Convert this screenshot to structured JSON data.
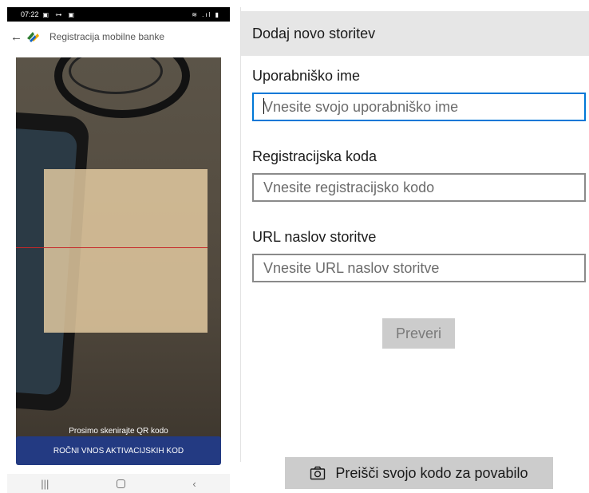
{
  "phone": {
    "status_time": "07:22",
    "status_left_icons": "▣ ⊶ ▣",
    "status_right_icons": "≋ .ıl ▮",
    "back_icon": "←",
    "app_title": "Registracija mobilne banke",
    "scan_hint": "Prosimo skenirajte QR kodo",
    "manual_entry_label": "ROČNI VNOS AKTIVACIJSKIH KOD",
    "nav": {
      "recents": "|||",
      "back": "‹"
    },
    "brand_colors": {
      "primary_button": "#233a82",
      "scan_line": "#c62828"
    }
  },
  "form": {
    "header_title": "Dodaj novo storitev",
    "fields": [
      {
        "label": "Uporabniško ime",
        "placeholder": "Vnesite svojo uporabniško ime",
        "value": "",
        "focused": true
      },
      {
        "label": "Registracijska koda",
        "placeholder": "Vnesite registracijsko kodo",
        "value": ""
      },
      {
        "label": "URL naslov storitve",
        "placeholder": "Vnesite URL naslov storitve",
        "value": ""
      }
    ],
    "check_button_label": "Preveri",
    "scan_invite_label": "Preišči svojo kodo za povabilo",
    "scan_invite_icon": "camera-icon",
    "accent_color": "#0078d7"
  }
}
